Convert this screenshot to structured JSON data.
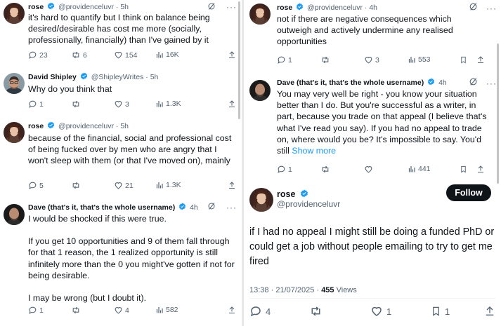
{
  "left": {
    "tweets": [
      {
        "name": "rose",
        "handle": "@providenceluvr",
        "dot": "·",
        "time": "5h",
        "body": "it's hard to quantify but I think on balance being desired/desirable has cost me more (socially, professionally, financially) than I've gained by it",
        "replies": "23",
        "reposts": "6",
        "likes": "154",
        "views": "16K"
      },
      {
        "name": "David Shipley",
        "handle": "@ShipleyWrites",
        "dot": "·",
        "time": "5h",
        "body": "Why do you think that",
        "replies": "1",
        "reposts": "",
        "likes": "3",
        "views": "1.3K"
      },
      {
        "name": "rose",
        "handle": "@providenceluvr",
        "dot": "·",
        "time": "5h",
        "body": "because of the financial, social and professional cost of being fucked over by men who are angry that I won't sleep with them (or that I've moved on), mainly",
        "replies": "5",
        "reposts": "",
        "likes": "21",
        "views": "1.3K"
      },
      {
        "name": "Dave (that's it, that's the whole username)",
        "time": "4h",
        "paragraphs": [
          "I would be shocked if this were true.",
          "If you get 10 opportunities and 9 of them fall through for that 1 reason, the 1 realized opportunity is still infinitely more than the 0 you might've gotten if not for being desirable.",
          "I may be wrong (but I doubt it)."
        ],
        "replies": "1",
        "reposts": "",
        "likes": "4",
        "views": "582"
      }
    ]
  },
  "right": {
    "tweets": [
      {
        "name": "rose",
        "handle": "@providenceluvr",
        "dot": "·",
        "time": "4h",
        "body": "not if there are negative consequences which outweigh and actively undermine any realised opportunities",
        "replies": "1",
        "reposts": "",
        "likes": "3",
        "views": "553"
      },
      {
        "name": "Dave (that's it, that's the whole username)",
        "time": "4h",
        "body": "You may very well be right - you know your situation better than I do. But you're successful as a writer, in part, because you trade on that appeal (I believe that's what I've read you say). If you had no appeal to trade on, where would you be? It's impossible to say. You'd still",
        "show_more": "Show more",
        "replies": "1",
        "reposts": "",
        "likes": "",
        "views": "441"
      }
    ],
    "main_tweet": {
      "name": "rose",
      "handle": "@providenceluvr",
      "follow_label": "Follow",
      "body": "if I had no appeal I might still be doing a funded PhD or could get a job without people emailing to try to get me fired",
      "time": "13:38",
      "date": "21/07/2025",
      "views_count": "455",
      "views_label": "Views",
      "replies": "4",
      "reposts": "",
      "likes": "1",
      "bookmarks": "1"
    }
  },
  "colors": {
    "verified": "#1d9bf0",
    "text": "#0f1419",
    "secondary": "#536471",
    "link": "#1d9bf0"
  }
}
